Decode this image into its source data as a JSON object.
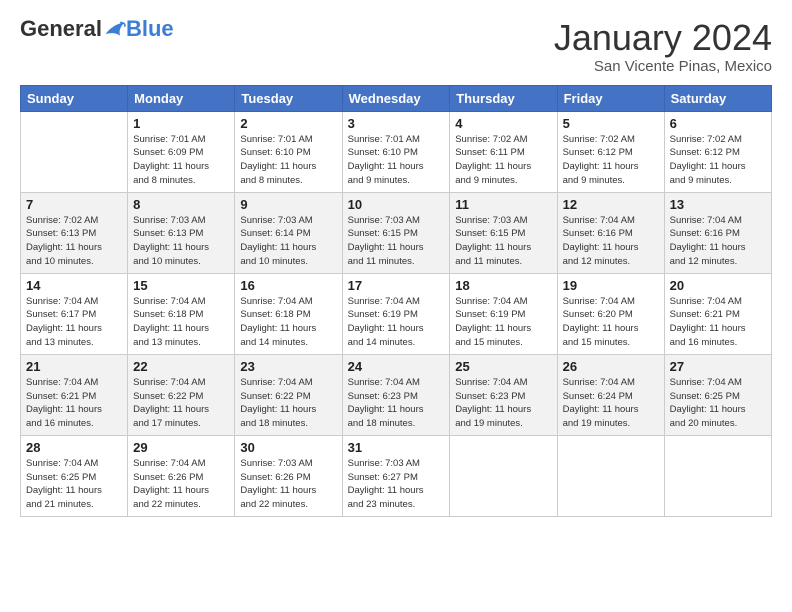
{
  "header": {
    "logo_general": "General",
    "logo_blue": "Blue",
    "month_title": "January 2024",
    "location": "San Vicente Pinas, Mexico"
  },
  "weekdays": [
    "Sunday",
    "Monday",
    "Tuesday",
    "Wednesday",
    "Thursday",
    "Friday",
    "Saturday"
  ],
  "weeks": [
    [
      {
        "day": "",
        "info": ""
      },
      {
        "day": "1",
        "info": "Sunrise: 7:01 AM\nSunset: 6:09 PM\nDaylight: 11 hours\nand 8 minutes."
      },
      {
        "day": "2",
        "info": "Sunrise: 7:01 AM\nSunset: 6:10 PM\nDaylight: 11 hours\nand 8 minutes."
      },
      {
        "day": "3",
        "info": "Sunrise: 7:01 AM\nSunset: 6:10 PM\nDaylight: 11 hours\nand 9 minutes."
      },
      {
        "day": "4",
        "info": "Sunrise: 7:02 AM\nSunset: 6:11 PM\nDaylight: 11 hours\nand 9 minutes."
      },
      {
        "day": "5",
        "info": "Sunrise: 7:02 AM\nSunset: 6:12 PM\nDaylight: 11 hours\nand 9 minutes."
      },
      {
        "day": "6",
        "info": "Sunrise: 7:02 AM\nSunset: 6:12 PM\nDaylight: 11 hours\nand 9 minutes."
      }
    ],
    [
      {
        "day": "7",
        "info": "Sunrise: 7:02 AM\nSunset: 6:13 PM\nDaylight: 11 hours\nand 10 minutes."
      },
      {
        "day": "8",
        "info": "Sunrise: 7:03 AM\nSunset: 6:13 PM\nDaylight: 11 hours\nand 10 minutes."
      },
      {
        "day": "9",
        "info": "Sunrise: 7:03 AM\nSunset: 6:14 PM\nDaylight: 11 hours\nand 10 minutes."
      },
      {
        "day": "10",
        "info": "Sunrise: 7:03 AM\nSunset: 6:15 PM\nDaylight: 11 hours\nand 11 minutes."
      },
      {
        "day": "11",
        "info": "Sunrise: 7:03 AM\nSunset: 6:15 PM\nDaylight: 11 hours\nand 11 minutes."
      },
      {
        "day": "12",
        "info": "Sunrise: 7:04 AM\nSunset: 6:16 PM\nDaylight: 11 hours\nand 12 minutes."
      },
      {
        "day": "13",
        "info": "Sunrise: 7:04 AM\nSunset: 6:16 PM\nDaylight: 11 hours\nand 12 minutes."
      }
    ],
    [
      {
        "day": "14",
        "info": "Sunrise: 7:04 AM\nSunset: 6:17 PM\nDaylight: 11 hours\nand 13 minutes."
      },
      {
        "day": "15",
        "info": "Sunrise: 7:04 AM\nSunset: 6:18 PM\nDaylight: 11 hours\nand 13 minutes."
      },
      {
        "day": "16",
        "info": "Sunrise: 7:04 AM\nSunset: 6:18 PM\nDaylight: 11 hours\nand 14 minutes."
      },
      {
        "day": "17",
        "info": "Sunrise: 7:04 AM\nSunset: 6:19 PM\nDaylight: 11 hours\nand 14 minutes."
      },
      {
        "day": "18",
        "info": "Sunrise: 7:04 AM\nSunset: 6:19 PM\nDaylight: 11 hours\nand 15 minutes."
      },
      {
        "day": "19",
        "info": "Sunrise: 7:04 AM\nSunset: 6:20 PM\nDaylight: 11 hours\nand 15 minutes."
      },
      {
        "day": "20",
        "info": "Sunrise: 7:04 AM\nSunset: 6:21 PM\nDaylight: 11 hours\nand 16 minutes."
      }
    ],
    [
      {
        "day": "21",
        "info": "Sunrise: 7:04 AM\nSunset: 6:21 PM\nDaylight: 11 hours\nand 16 minutes."
      },
      {
        "day": "22",
        "info": "Sunrise: 7:04 AM\nSunset: 6:22 PM\nDaylight: 11 hours\nand 17 minutes."
      },
      {
        "day": "23",
        "info": "Sunrise: 7:04 AM\nSunset: 6:22 PM\nDaylight: 11 hours\nand 18 minutes."
      },
      {
        "day": "24",
        "info": "Sunrise: 7:04 AM\nSunset: 6:23 PM\nDaylight: 11 hours\nand 18 minutes."
      },
      {
        "day": "25",
        "info": "Sunrise: 7:04 AM\nSunset: 6:23 PM\nDaylight: 11 hours\nand 19 minutes."
      },
      {
        "day": "26",
        "info": "Sunrise: 7:04 AM\nSunset: 6:24 PM\nDaylight: 11 hours\nand 19 minutes."
      },
      {
        "day": "27",
        "info": "Sunrise: 7:04 AM\nSunset: 6:25 PM\nDaylight: 11 hours\nand 20 minutes."
      }
    ],
    [
      {
        "day": "28",
        "info": "Sunrise: 7:04 AM\nSunset: 6:25 PM\nDaylight: 11 hours\nand 21 minutes."
      },
      {
        "day": "29",
        "info": "Sunrise: 7:04 AM\nSunset: 6:26 PM\nDaylight: 11 hours\nand 22 minutes."
      },
      {
        "day": "30",
        "info": "Sunrise: 7:03 AM\nSunset: 6:26 PM\nDaylight: 11 hours\nand 22 minutes."
      },
      {
        "day": "31",
        "info": "Sunrise: 7:03 AM\nSunset: 6:27 PM\nDaylight: 11 hours\nand 23 minutes."
      },
      {
        "day": "",
        "info": ""
      },
      {
        "day": "",
        "info": ""
      },
      {
        "day": "",
        "info": ""
      }
    ]
  ]
}
